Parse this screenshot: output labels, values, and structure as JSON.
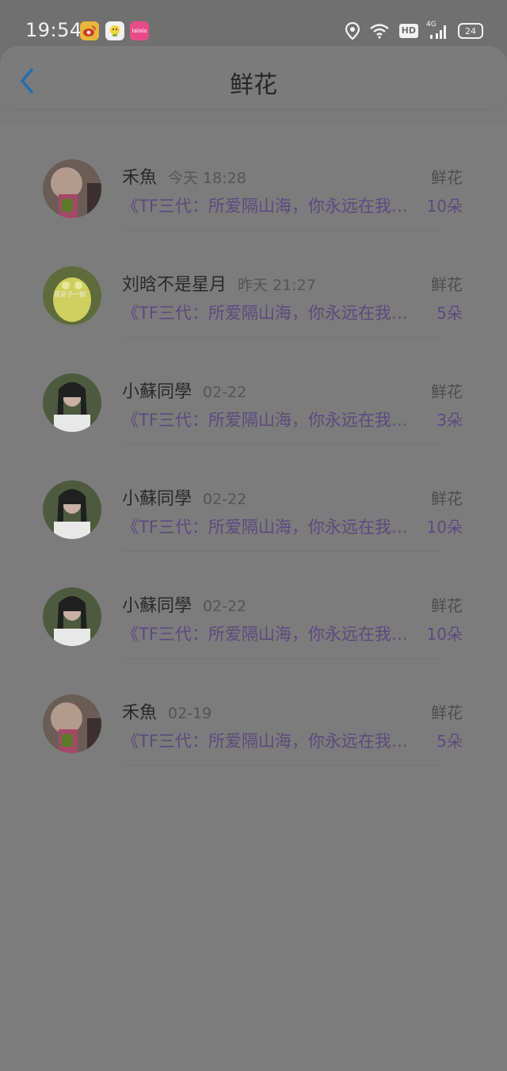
{
  "status_bar": {
    "time": "19:54",
    "app_icons": [
      "weibo-icon",
      "duck-app-icon",
      "lalala-app-icon"
    ],
    "app3_text": "lalala",
    "network": "4G",
    "hd_label": "HD",
    "battery": "24"
  },
  "header": {
    "title": "鲜花",
    "back_icon": "chevron-left-icon",
    "accent": "#1f6fb3"
  },
  "list": {
    "items": [
      {
        "name": "禾魚",
        "time": "今天 18:28",
        "message": "《TF三代：所爱隔山海，你永远在我心上》",
        "label": "鲜花",
        "count": "10朵",
        "avatar": "avatar-1"
      },
      {
        "name": "刘晗不是星月",
        "time": "昨天 21:27",
        "message": "《TF三代：所爱隔山海，你永远在我心上》",
        "label": "鲜花",
        "count": "5朵",
        "avatar": "avatar-2",
        "avatar_text": "耳朵子一刻"
      },
      {
        "name": "小蘇同學",
        "time": "02-22",
        "message": "《TF三代：所爱隔山海，你永远在我心上》",
        "label": "鲜花",
        "count": "3朵",
        "avatar": "avatar-3"
      },
      {
        "name": "小蘇同學",
        "time": "02-22",
        "message": "《TF三代：所爱隔山海，你永远在我心上》",
        "label": "鲜花",
        "count": "10朵",
        "avatar": "avatar-3"
      },
      {
        "name": "小蘇同學",
        "time": "02-22",
        "message": "《TF三代：所爱隔山海，你永远在我心上》",
        "label": "鲜花",
        "count": "10朵",
        "avatar": "avatar-3"
      },
      {
        "name": "禾魚",
        "time": "02-19",
        "message": "《TF三代：所爱隔山海，你永远在我心上》",
        "label": "鲜花",
        "count": "5朵",
        "avatar": "avatar-1"
      }
    ]
  }
}
